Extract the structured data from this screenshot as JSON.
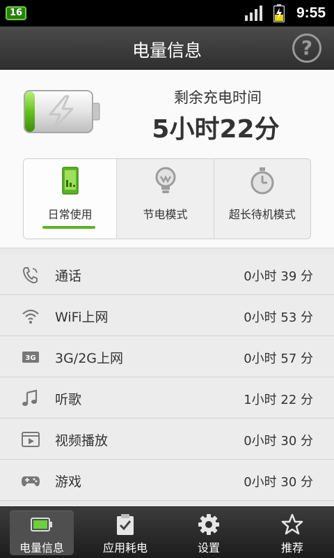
{
  "status_bar": {
    "badge": "16",
    "time": "9:55"
  },
  "header": {
    "title": "电量信息",
    "help_label": "?"
  },
  "summary": {
    "remaining_label": "剩余充电时间",
    "remaining_time": "5小时22分"
  },
  "modes": [
    {
      "label": "日常使用",
      "icon": "phone-battery-icon",
      "selected": true
    },
    {
      "label": "节电模式",
      "icon": "lightbulb-icon",
      "selected": false
    },
    {
      "label": "超长待机模式",
      "icon": "stopwatch-icon",
      "selected": false
    }
  ],
  "usage": [
    {
      "icon": "phone-icon",
      "label": "通话",
      "value": "0小时 39 分"
    },
    {
      "icon": "wifi-icon",
      "label": "WiFi上网",
      "value": "0小时 53 分"
    },
    {
      "icon": "3g-icon",
      "label": "3G/2G上网",
      "value": "0小时 57 分"
    },
    {
      "icon": "music-note-icon",
      "label": "听歌",
      "value": "1小时 22 分"
    },
    {
      "icon": "video-icon",
      "label": "视频播放",
      "value": "0小时 30 分"
    },
    {
      "icon": "gamepad-icon",
      "label": "游戏",
      "value": "0小时 30 分"
    }
  ],
  "bottom_nav": [
    {
      "label": "电量信息",
      "icon": "battery-icon",
      "active": true
    },
    {
      "label": "应用耗电",
      "icon": "clipboard-check-icon",
      "active": false
    },
    {
      "label": "设置",
      "icon": "gear-icon",
      "active": false
    },
    {
      "label": "推荐",
      "icon": "star-icon",
      "active": false
    }
  ],
  "colors": {
    "accent": "#5cb326",
    "titlebar": "#3c3c3c",
    "list_bg": "#ececec"
  }
}
